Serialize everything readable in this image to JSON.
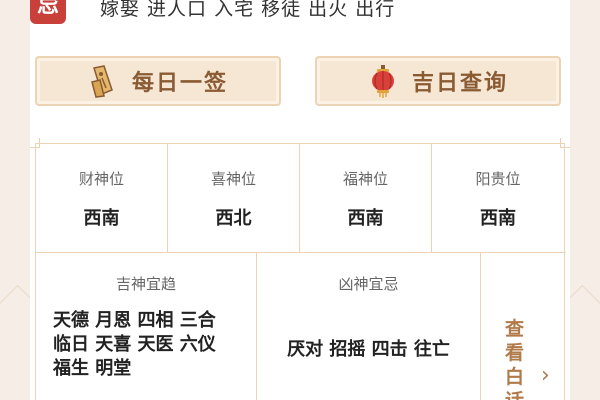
{
  "avoid": {
    "badge": "忌",
    "items": "嫁娶  进人口  入宅  移徒  出火  出行"
  },
  "buttons": {
    "daily_sign": "每日一签",
    "lucky_day": "吉日查询"
  },
  "gods": [
    {
      "label": "财神位",
      "value": "西南"
    },
    {
      "label": "喜神位",
      "value": "西北"
    },
    {
      "label": "福神位",
      "value": "西南"
    },
    {
      "label": "阳贵位",
      "value": "西南"
    }
  ],
  "good_gods": {
    "title": "吉神宜趋",
    "lines": [
      "天德 月恩 四相 三合",
      "临日 天喜 天医 六仪",
      "福生 明堂"
    ]
  },
  "bad_gods": {
    "title": "凶神宜忌",
    "text": "厌对 招摇 四击 往亡"
  },
  "more": {
    "label": "查看白话"
  },
  "colors": {
    "accent": "#c9403a",
    "gold_text": "#8a5a33",
    "border": "#ecd3b4"
  }
}
